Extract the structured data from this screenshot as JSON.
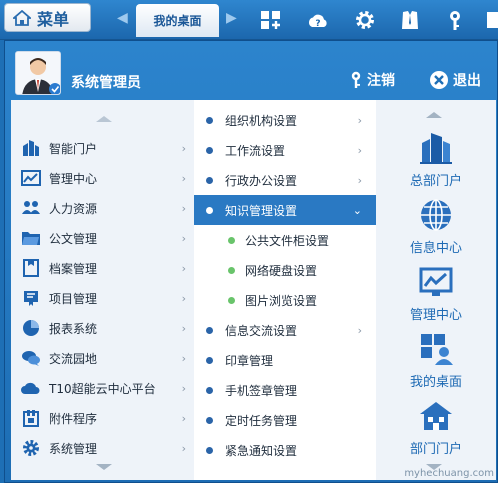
{
  "topbar": {
    "menu_label": "菜单",
    "active_tab": "我的桌面",
    "colors": {
      "bar": "#1c67ad",
      "accent": "#2a79c3"
    }
  },
  "user": {
    "name": "系统管理员",
    "logout_label": "注销",
    "exit_label": "退出"
  },
  "categories": [
    {
      "label": "智能门户",
      "icon": "building-icon"
    },
    {
      "label": "管理中心",
      "icon": "chart-icon"
    },
    {
      "label": "人力资源",
      "icon": "people-icon"
    },
    {
      "label": "公文管理",
      "icon": "folder-icon"
    },
    {
      "label": "档案管理",
      "icon": "archive-icon"
    },
    {
      "label": "项目管理",
      "icon": "clipboard-icon"
    },
    {
      "label": "报表系统",
      "icon": "pie-chart-icon"
    },
    {
      "label": "交流园地",
      "icon": "chat-icon"
    },
    {
      "label": "T10超能云中心平台",
      "icon": "cloud-icon"
    },
    {
      "label": "附件程序",
      "icon": "plugin-icon"
    },
    {
      "label": "系统管理",
      "icon": "gear-icon"
    }
  ],
  "submenu": [
    {
      "label": "组织机构设置",
      "type": "item",
      "arrow": true
    },
    {
      "label": "工作流设置",
      "type": "item",
      "arrow": true
    },
    {
      "label": "行政办公设置",
      "type": "item",
      "arrow": true
    },
    {
      "label": "知识管理设置",
      "type": "active",
      "arrow": true
    },
    {
      "label": "公共文件柜设置",
      "type": "sub"
    },
    {
      "label": "网络硬盘设置",
      "type": "sub"
    },
    {
      "label": "图片浏览设置",
      "type": "sub"
    },
    {
      "label": "信息交流设置",
      "type": "item",
      "arrow": true
    },
    {
      "label": "印章管理",
      "type": "item"
    },
    {
      "label": "手机签章管理",
      "type": "item"
    },
    {
      "label": "定时任务管理",
      "type": "item"
    },
    {
      "label": "紧急通知设置",
      "type": "item"
    }
  ],
  "quick": [
    {
      "label": "总部门户",
      "icon": "hq-building-icon"
    },
    {
      "label": "信息中心",
      "icon": "globe-icon"
    },
    {
      "label": "管理中心",
      "icon": "monitor-chart-icon"
    },
    {
      "label": "我的桌面",
      "icon": "desktop-user-icon"
    },
    {
      "label": "部门门户",
      "icon": "house-icon"
    }
  ],
  "watermark": "myhechuang.com"
}
